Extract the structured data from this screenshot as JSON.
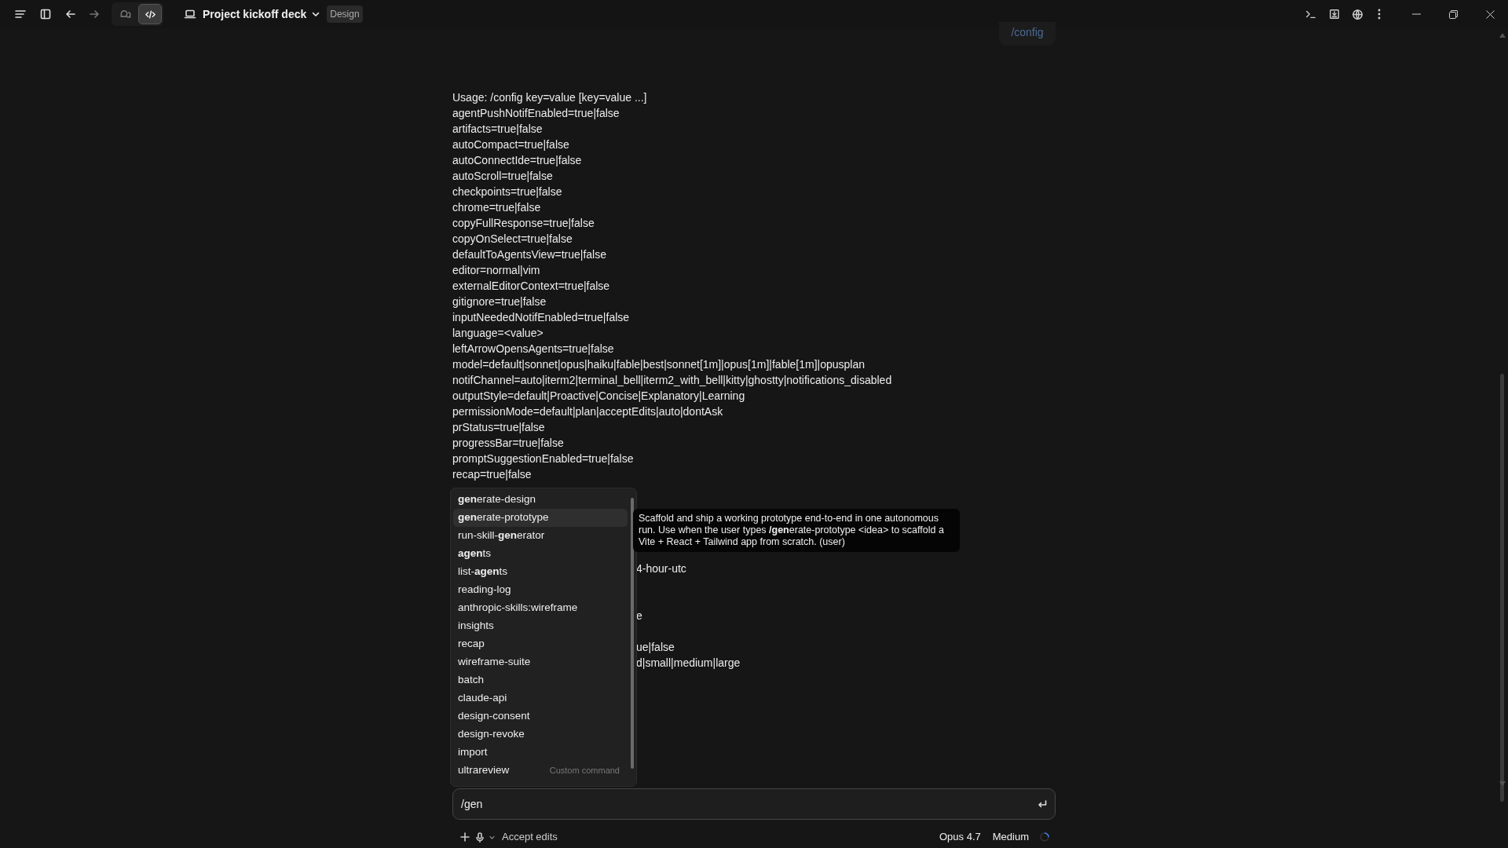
{
  "title_bar": {
    "project": "Project kickoff deck",
    "badge": "Design",
    "forward_enabled": false,
    "view_modes": [
      {
        "kind": "chat",
        "selected": false
      },
      {
        "kind": "code",
        "selected": true
      }
    ]
  },
  "user_message": "/config",
  "output_lines": [
    "Usage: /config key=value [key=value ...]",
    "agentPushNotifEnabled=true|false",
    "artifacts=true|false",
    "autoCompact=true|false",
    "autoConnectIde=true|false",
    "autoScroll=true|false",
    "checkpoints=true|false",
    "chrome=true|false",
    "copyFullResponse=true|false",
    "copyOnSelect=true|false",
    "defaultToAgentsView=true|false",
    "editor=normal|vim",
    "externalEditorContext=true|false",
    "gitignore=true|false",
    "inputNeededNotifEnabled=true|false",
    "language=<value>",
    "leftArrowOpensAgents=true|false",
    "model=default|sonnet|opus|haiku|fable|best|sonnet[1m]|opus[1m]|fable[1m]|opusplan",
    "notifChannel=auto|iterm2|terminal_bell|iterm2_with_bell|kitty|ghostty|notifications_disabled",
    "outputStyle=default|Proactive|Concise|Explanatory|Learning",
    "permissionMode=default|plan|acceptEdits|auto|dontAsk",
    "prStatus=true|false",
    "progressBar=true|false",
    "promptSuggestionEnabled=true|false",
    "recap=true|false"
  ],
  "covered_line_fragments": [
    "4-hour-utc",
    "e",
    "ue|false",
    "d|small|medium|large"
  ],
  "suggestions": [
    {
      "label": "**gen**erate-design",
      "selected": false
    },
    {
      "label": "**gen**erate-prototype",
      "selected": true
    },
    {
      "label": "run-skill-**gen**erator",
      "selected": false
    },
    {
      "label": "**agen**ts",
      "selected": false
    },
    {
      "label": "list-**agen**ts",
      "selected": false
    },
    {
      "label": "reading-log",
      "selected": false
    },
    {
      "label": "anthropic-skills:wireframe",
      "selected": false
    },
    {
      "label": "insights",
      "selected": false
    },
    {
      "label": "recap",
      "selected": false
    },
    {
      "label": "wireframe-suite",
      "selected": false
    },
    {
      "label": "batch",
      "selected": false
    },
    {
      "label": "claude-api",
      "selected": false
    },
    {
      "label": "design-consent",
      "selected": false
    },
    {
      "label": "design-revoke",
      "selected": false
    },
    {
      "label": "import",
      "selected": false
    },
    {
      "label": "ultrareview",
      "hint": "Custom command",
      "selected": false
    }
  ],
  "tooltip": "Scaffold and ship a working prototype end-to-end in one autonomous run. Use when the user types **/gen**erate-prototype <idea> to scaffold a Vite + React + Tailwind app from scratch. (user)",
  "input": {
    "value": "/gen"
  },
  "footer": {
    "mode": "Accept edits",
    "model": "Opus 4.7",
    "effort": "Medium"
  }
}
